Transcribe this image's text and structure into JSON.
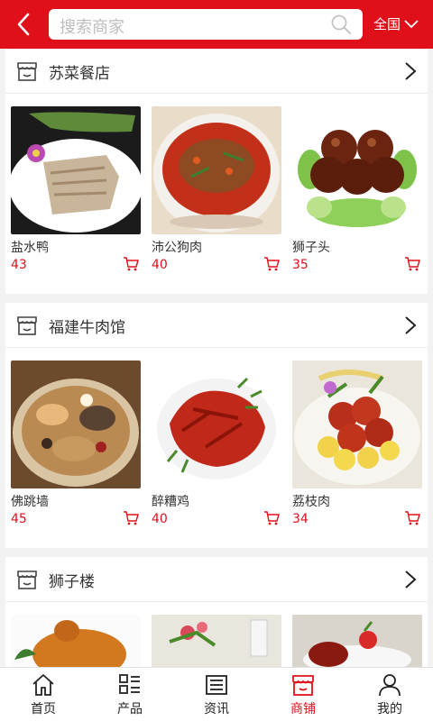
{
  "header": {
    "search_placeholder": "搜索商家",
    "region": "全国"
  },
  "shops": [
    {
      "name": "苏菜餐店",
      "items": [
        {
          "name": "盐水鸭",
          "price": "43"
        },
        {
          "name": "沛公狗肉",
          "price": "40"
        },
        {
          "name": "狮子头",
          "price": "35"
        }
      ]
    },
    {
      "name": "福建牛肉馆",
      "items": [
        {
          "name": "佛跳墙",
          "price": "45"
        },
        {
          "name": "醉糟鸡",
          "price": "40"
        },
        {
          "name": "荔枝肉",
          "price": "34"
        }
      ]
    },
    {
      "name": "狮子楼",
      "items": []
    }
  ],
  "tabbar": {
    "items": [
      {
        "label": "首页",
        "icon": "home-icon"
      },
      {
        "label": "产品",
        "icon": "product-list-icon"
      },
      {
        "label": "资讯",
        "icon": "news-icon"
      },
      {
        "label": "商铺",
        "icon": "shop-icon"
      },
      {
        "label": "我的",
        "icon": "user-icon"
      }
    ],
    "active_index": 3
  },
  "colors": {
    "brand_red": "#e0101a",
    "background": "#f2f2f2"
  }
}
